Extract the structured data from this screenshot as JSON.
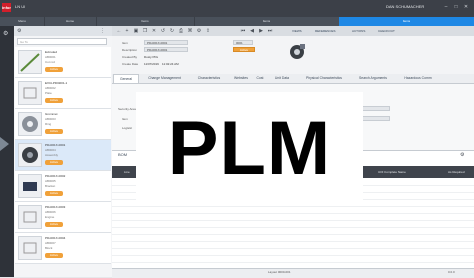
{
  "app": {
    "logo_text": "infor",
    "title": "LN UI",
    "user": "DAN SCHUMACHER"
  },
  "tabs": [
    {
      "label": "Menu"
    },
    {
      "label": "Home"
    },
    {
      "label": "Items"
    },
    {
      "label": "Items"
    },
    {
      "label": "Items",
      "active": true
    }
  ],
  "list": {
    "search_placeholder": "Go To",
    "items": [
      {
        "name": "Extruded",
        "id": "AB0001",
        "desc": "Cut rod",
        "badge": "Active"
      },
      {
        "name": "EXCLPDI4001-1",
        "id": "AB0002",
        "desc": "Plate",
        "badge": "Active"
      },
      {
        "name": "Grommet",
        "id": "AB0003",
        "desc": "Ring",
        "badge": "Active"
      },
      {
        "name": "PDx001X-0001",
        "id": "AB0004",
        "desc": "Assembly",
        "badge": "Active",
        "selected": true
      },
      {
        "name": "PDx001X-0002",
        "id": "AB0005",
        "desc": "Bracket",
        "badge": "Active"
      },
      {
        "name": "PDx001X-0003",
        "id": "AB0006",
        "desc": "Engine",
        "badge": "Active"
      },
      {
        "name": "PDx001X-0004",
        "id": "AB0007",
        "desc": "Block",
        "badge": "Active"
      }
    ]
  },
  "toolbar": {
    "views_label": "VIEWS",
    "references_label": "REFERENCES",
    "actions_label": "ACTIONS",
    "checkout_label": "CHECKOUT"
  },
  "form": {
    "item_label": "Item",
    "item_value": "PDx001X-0001",
    "item_rev": "0001",
    "description_label": "Description",
    "description_value": "PDx001X-0001",
    "created_by_label": "Created By",
    "created_by_value": "Dusty PDx",
    "created_date_label": "Create Date",
    "created_date_value": "11/07/2019",
    "created_time_value": "11:02:24 AM",
    "status_value": "Active"
  },
  "subtabs": [
    {
      "label": "General",
      "active": true
    },
    {
      "label": "Change Management"
    },
    {
      "label": "Characteristics"
    },
    {
      "label": "Websites"
    },
    {
      "label": "Cost"
    },
    {
      "label": "Unit Data"
    },
    {
      "label": "Physical Characteristics"
    },
    {
      "label": "Search Arguments"
    },
    {
      "label": "Hazardous Comm"
    }
  ],
  "body": {
    "security_label": "Security Area",
    "item_type_label": "Item",
    "logistic_label": "Logistic"
  },
  "grid": {
    "title": "BOM",
    "columns": [
      "Line",
      "Item",
      "Description",
      "Qty",
      "UOM",
      "LN Revision",
      "UOI Complete Name",
      "As Required"
    ]
  },
  "footer": {
    "status": "Layout 0000-001",
    "right": "0.0.0"
  },
  "overlay": {
    "text": "PLM"
  }
}
